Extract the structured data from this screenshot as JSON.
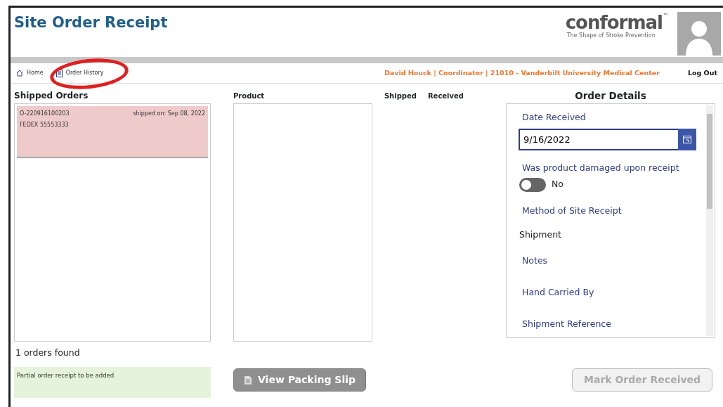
{
  "header": {
    "title": "Site Order Receipt",
    "logo": {
      "name": "conformal",
      "trademark": "™",
      "tagline": "The Shape of Stroke Prevention"
    }
  },
  "nav": {
    "links": [
      {
        "label": "Home"
      },
      {
        "label": "Order History"
      }
    ],
    "user": "David Houck | Coordinator | 21010 - Vanderbilt University Medical Center",
    "logout": "Log Out"
  },
  "shipped_orders": {
    "title": "Shipped Orders",
    "items": [
      {
        "order": "O-220916100203",
        "shipped": "shipped on: Sep 08, 2022",
        "tracking": "FEDEX 55553333",
        "selected": true
      }
    ],
    "count": "1 orders found",
    "note": "Partial order receipt to be added"
  },
  "products": {
    "columns": [
      "Product",
      "Shipped",
      "Received"
    ]
  },
  "order_details": {
    "title": "Order Details",
    "date_label": "Date Received",
    "date_value": "9/16/2022",
    "damaged_label": "Was product damaged upon receipt",
    "damaged": {
      "on": false,
      "text": "No"
    },
    "method_label": "Method of Site Receipt",
    "method_value": "Shipment",
    "notes_label": "Notes",
    "carried_label": "Hand Carried By",
    "reference_label": "Shipment Reference"
  },
  "buttons": [
    {
      "label": "View Packing Slip",
      "disabled": false
    },
    {
      "label": "Mark Order Received",
      "disabled": true
    }
  ]
}
